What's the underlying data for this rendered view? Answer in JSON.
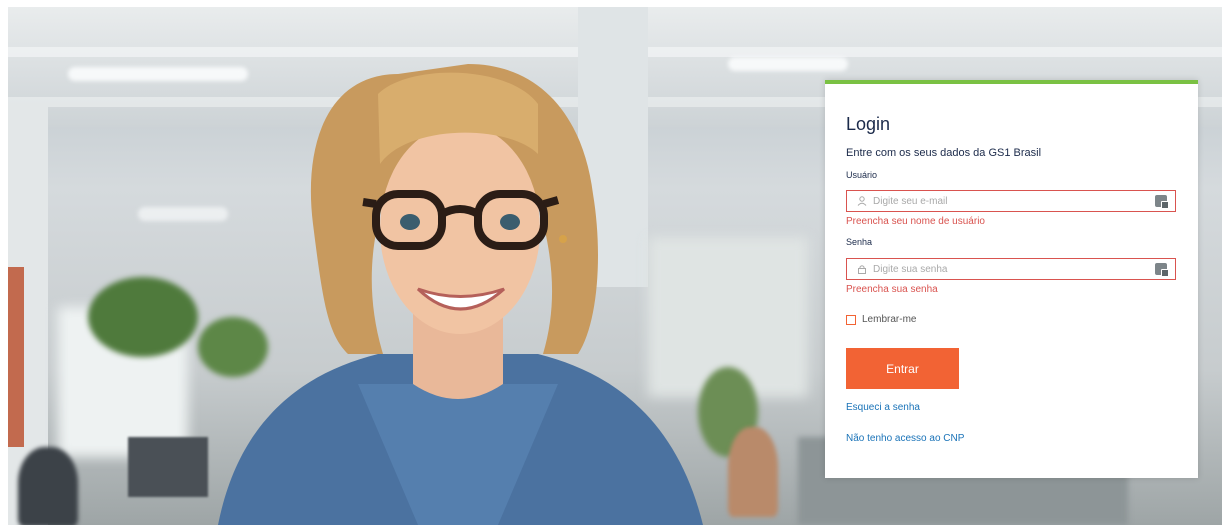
{
  "login": {
    "title": "Login",
    "subtitle": "Entre com os seus dados da GS1 Brasil",
    "username": {
      "label": "Usuário",
      "placeholder": "Digite seu e-mail",
      "value": "",
      "error": "Preencha seu nome de usuário"
    },
    "password": {
      "label": "Senha",
      "placeholder": "Digite sua senha",
      "value": "",
      "error": "Preencha sua senha"
    },
    "remember_label": "Lembrar-me",
    "remember_checked": false,
    "submit_label": "Entrar",
    "forgot_link": "Esqueci a senha",
    "no_access_link": "Não tenho acesso ao CNP"
  },
  "colors": {
    "accent_green": "#7ac143",
    "button_orange": "#f26334",
    "error_red": "#d9534f",
    "link_blue": "#1a73b8",
    "title_navy": "#1b2a4a"
  },
  "icons": {
    "username_field": "user-icon",
    "password_field": "lock-icon",
    "field_addon": "keyboard-icon"
  }
}
